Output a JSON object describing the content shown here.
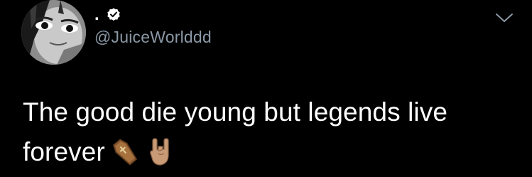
{
  "tweet": {
    "author": {
      "display_name": ".",
      "handle": "@JuiceWorlddd",
      "verified": true,
      "avatar_icon": "profile-avatar"
    },
    "text_line1": "The good die young but legends live",
    "text_line2": "forever",
    "emojis": [
      "coffin-emoji",
      "sign-of-horns-emoji"
    ],
    "more_icon": "chevron-down-icon"
  },
  "colors": {
    "background": "#000000",
    "text": "#ffffff",
    "handle": "#8b98a5",
    "verified_badge": "#ffffff"
  }
}
